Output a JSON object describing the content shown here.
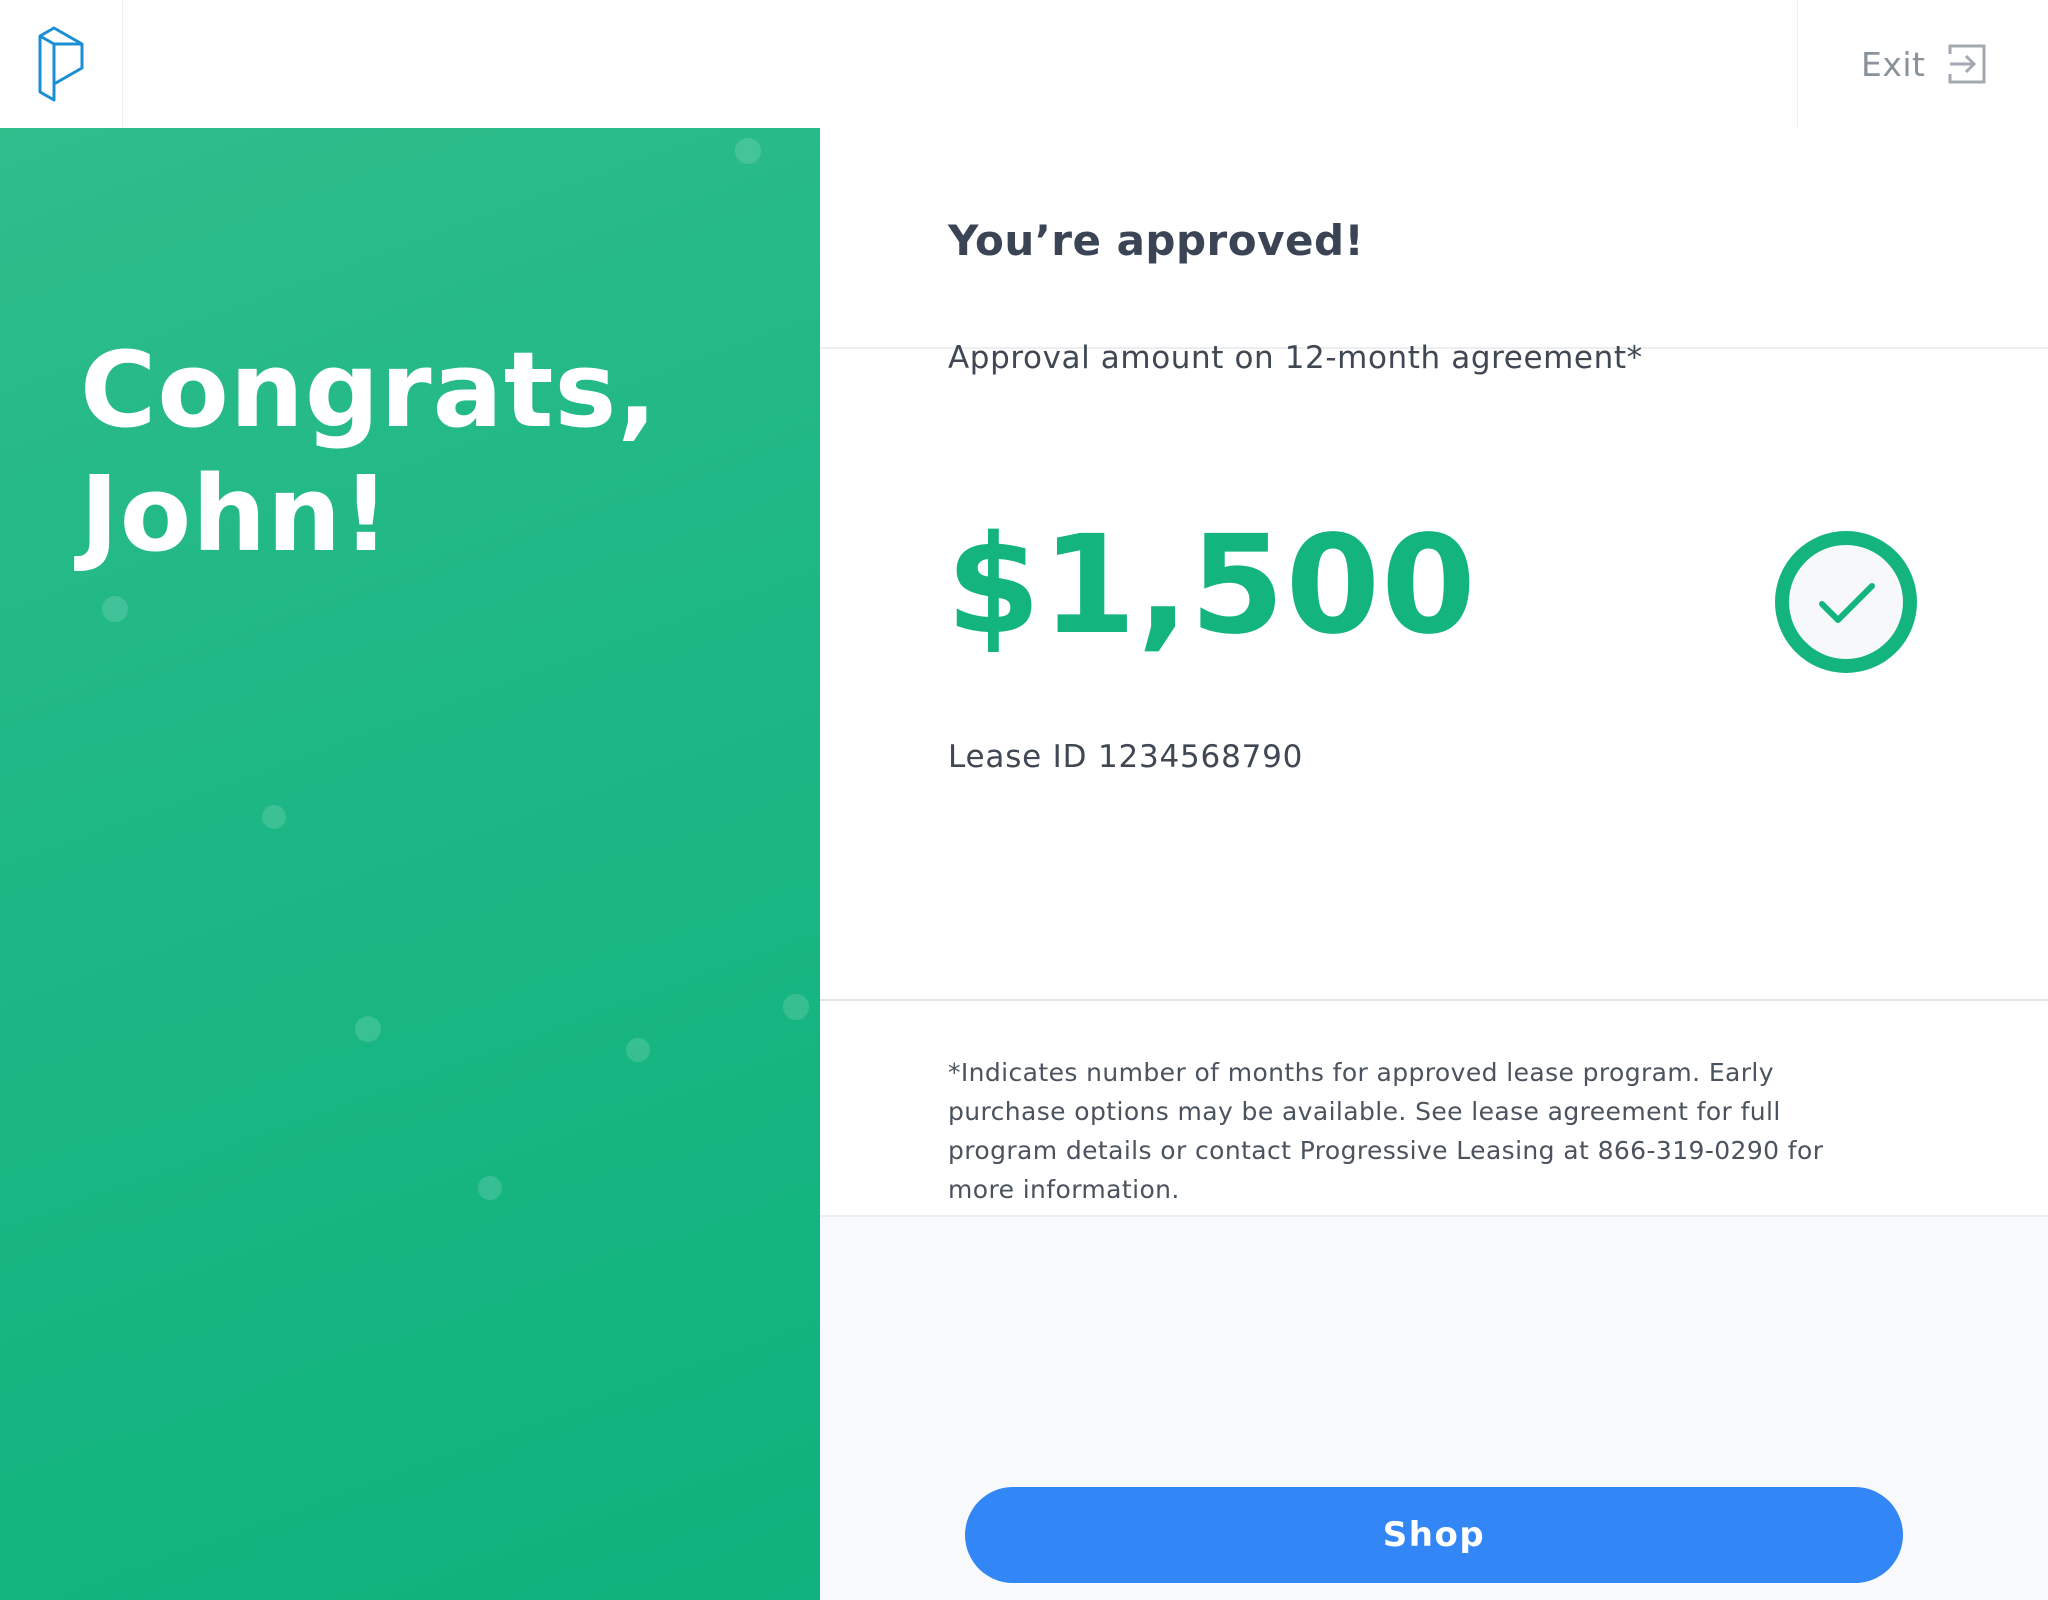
{
  "header": {
    "logo_icon": "progressive-p-logo-icon",
    "exit_label": "Exit",
    "exit_icon": "exit-arrow-icon"
  },
  "hero": {
    "greeting": "Congrats, John!"
  },
  "approval": {
    "title": "You’re approved!",
    "amount_caption": "Approval amount on 12-month agreement*",
    "amount": "$1,500",
    "check_icon": "check-circle-icon",
    "lease_id": "Lease ID 1234568790"
  },
  "footnote": "*Indicates number of months for approved lease program. Early purchase options may be available. See lease agreement for full program details or contact Progressive Leasing at 866-319-0290 for more information.",
  "actions": {
    "shop_label": "Shop"
  },
  "colors": {
    "brand_green": "#14b47f",
    "brand_blue": "#3286f6",
    "logo_blue": "#1b8fd6",
    "text_dark": "#3a4454"
  }
}
